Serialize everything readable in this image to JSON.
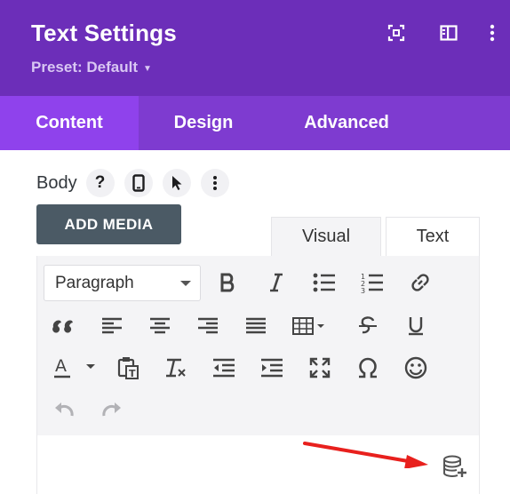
{
  "header": {
    "title": "Text Settings",
    "preset_label": "Preset: Default",
    "icons": [
      "focus-icon",
      "sidebar-toggle-icon",
      "more-vertical-icon"
    ],
    "background": "#6c2eb9"
  },
  "tabs": [
    {
      "label": "Content",
      "active": true
    },
    {
      "label": "Design",
      "active": false
    },
    {
      "label": "Advanced",
      "active": false
    }
  ],
  "field": {
    "label": "Body",
    "help_glyph": "?",
    "icons": [
      "help-icon",
      "mobile-icon",
      "pointer-icon",
      "more-vertical-icon"
    ]
  },
  "add_media": {
    "label": "ADD MEDIA",
    "background": "#4b5a65"
  },
  "editor_tabs": {
    "visual": "Visual",
    "text": "Text",
    "active": "Visual"
  },
  "toolbar": {
    "format_value": "Paragraph",
    "rows": [
      [
        "bold-icon",
        "italic-icon",
        "bullet-list-icon",
        "numbered-list-icon",
        "link-icon"
      ],
      [
        "blockquote-icon",
        "align-left-icon",
        "align-center-icon",
        "align-right-icon",
        "justify-icon",
        "table-icon",
        "strikethrough-icon",
        "underline-icon"
      ],
      [
        "text-color-icon",
        "paste-text-icon",
        "clear-formatting-icon",
        "outdent-icon",
        "indent-icon",
        "fullscreen-icon",
        "omega-icon",
        "emoji-icon"
      ],
      [
        "undo-icon",
        "redo-icon"
      ]
    ]
  },
  "content_area": {
    "icons": [
      "dynamic-content-icon",
      "red-arrow-annotation"
    ],
    "annotation_color": "#e8201d"
  }
}
